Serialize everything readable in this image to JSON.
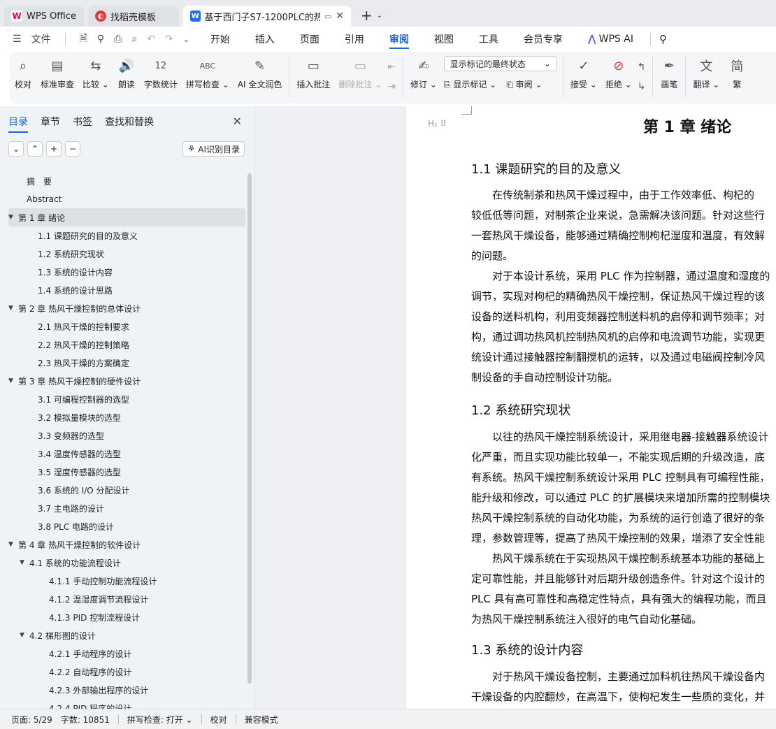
{
  "tabs": [
    {
      "label": "WPS Office"
    },
    {
      "label": "找稻壳模板"
    },
    {
      "label": "基于西门子S7-1200PLC的热风"
    }
  ],
  "menu": {
    "file": "文件",
    "items": [
      "开始",
      "插入",
      "页面",
      "引用",
      "审阅",
      "视图",
      "工具",
      "会员专享"
    ],
    "active_index": 4,
    "ai": "WPS AI"
  },
  "ribbon": {
    "proofread": "校对",
    "std_review": "标准审查",
    "compare": "比较",
    "read_aloud": "朗读",
    "word_count": "字数统计",
    "spell_check": "拼写检查",
    "ai_polish": "AI 全文润色",
    "insert_comment": "插入批注",
    "delete_comment": "删除批注",
    "revise": "修订",
    "markup_select": "显示标记的最终状态",
    "show_markup": "显示标记",
    "review": "审阅",
    "accept": "接受",
    "reject": "拒绝",
    "pen": "画笔",
    "translate": "翻译",
    "trad": "繁"
  },
  "panel": {
    "tabs": [
      "目录",
      "章节",
      "书签",
      "查找和替换"
    ],
    "ai_toc": "AI识别目录",
    "toc": [
      {
        "text": "摘　要",
        "level": 0
      },
      {
        "text": "Abstract",
        "level": 0
      },
      {
        "text": "第 1 章  绪论",
        "level": 0,
        "expandable": true,
        "selected": true
      },
      {
        "text": "1.1  课题研究的目的及意义",
        "level": 1
      },
      {
        "text": "1.2  系统研究现状",
        "level": 1
      },
      {
        "text": "1.3  系统的设计内容",
        "level": 1
      },
      {
        "text": "1.4  系统的设计思路",
        "level": 1
      },
      {
        "text": "第 2 章  热风干燥控制的总体设计",
        "level": 0,
        "expandable": true
      },
      {
        "text": "2.1  热风干燥的控制要求",
        "level": 1
      },
      {
        "text": "2.2  热风干燥的控制策略",
        "level": 1
      },
      {
        "text": "2.3  热风干燥的方案确定",
        "level": 1
      },
      {
        "text": "第 3 章  热风干燥控制的硬件设计",
        "level": 0,
        "expandable": true
      },
      {
        "text": "3.1  可编程控制器的选型",
        "level": 1
      },
      {
        "text": "3.2  模拟量模块的选型",
        "level": 1
      },
      {
        "text": "3.3  变频器的选型",
        "level": 1
      },
      {
        "text": "3.4  温度传感器的选型",
        "level": 1
      },
      {
        "text": "3.5  湿度传感器的选型",
        "level": 1
      },
      {
        "text": "3.6  系统的 I/O 分配设计",
        "level": 1
      },
      {
        "text": "3.7  主电路的设计",
        "level": 1
      },
      {
        "text": "3.8 PLC 电路的设计",
        "level": 1
      },
      {
        "text": "第 4 章  热风干燥控制的软件设计",
        "level": 0,
        "expandable": true
      },
      {
        "text": "4.1  系统的功能流程设计",
        "level": 1,
        "expandable": true
      },
      {
        "text": "4.1.1  手动控制功能流程设计",
        "level": 2
      },
      {
        "text": "4.1.2  温湿度调节流程设计",
        "level": 2
      },
      {
        "text": "4.1.3 PID 控制流程设计",
        "level": 2
      },
      {
        "text": "4.2  梯形图的设计",
        "level": 1,
        "expandable": true
      },
      {
        "text": "4.2.1  手动程序的设计",
        "level": 2
      },
      {
        "text": "4.2.2  自动程序的设计",
        "level": 2
      },
      {
        "text": "4.2.3  外部输出程序的设计",
        "level": 2
      },
      {
        "text": "4.2.4 PID 程序的设计",
        "level": 2
      }
    ]
  },
  "doc": {
    "title": "第 1 章  绪论",
    "h_1_1": "1.1  课题研究的目的及意义",
    "p1": [
      "　　在传统制茶和热风干燥过程中，由于工作效率低、枸杞的",
      "较低低等问题，对制茶企业来说，急需解决该问题。针对这些行",
      "一套热风干燥设备，能够通过精确控制枸杞湿度和温度，有效解",
      "的问题。",
      "　　对于本设计系统，采用 PLC 作为控制器，通过温度和湿度的",
      "调节，实现对枸杞的精确热风干燥控制，保证热风干燥过程的该",
      "设备的送料机构，利用变频器控制送料机的启停和调节频率；对",
      "构，通过调功热风机控制热风机的启停和电流调节功能，实现更",
      "统设计通过接触器控制翻搅机的运转，以及通过电磁阀控制冷风",
      "制设备的手自动控制设计功能。"
    ],
    "h_1_2": "1.2  系统研究现状",
    "p2": [
      "　　以往的热风干燥控制系统设计，采用继电器-接触器系统设计",
      "化严重，而且实现功能比较单一，不能实现后期的升级改造，底",
      "有系统。热风干燥控制系统设计采用 PLC 控制具有可编程性能，",
      "能升级和修改，可以通过 PLC 的扩展模块来增加所需的控制模块",
      "热风干燥控制系统的自动化功能，为系统的运行创造了很好的条",
      "理，参数管理等，提高了热风干燥控制的效果，增添了安全性能",
      "　　热风干燥系统在于实现热风干燥控制系统基本功能的基础上",
      "定可靠性能，并且能够针对后期升级创造条件。针对这个设计的",
      "PLC 具有高可靠性和高稳定性特点，具有强大的编程功能，而且",
      "为热风干燥控制系统注入很好的电气自动化基础。"
    ],
    "h_1_3": "1.3  系统的设计内容",
    "p3": [
      "　　对于热风干燥设备控制，主要通过加料机往热风干燥设备内",
      "干燥设备的内腔翻炒，在高温下，使枸杞发生一些质的变化，并"
    ]
  },
  "status": {
    "page": "页面: 5/29",
    "words": "字数: 10851",
    "spell": "拼写检查: 打开",
    "proof": "校对",
    "compat": "兼容模式"
  }
}
